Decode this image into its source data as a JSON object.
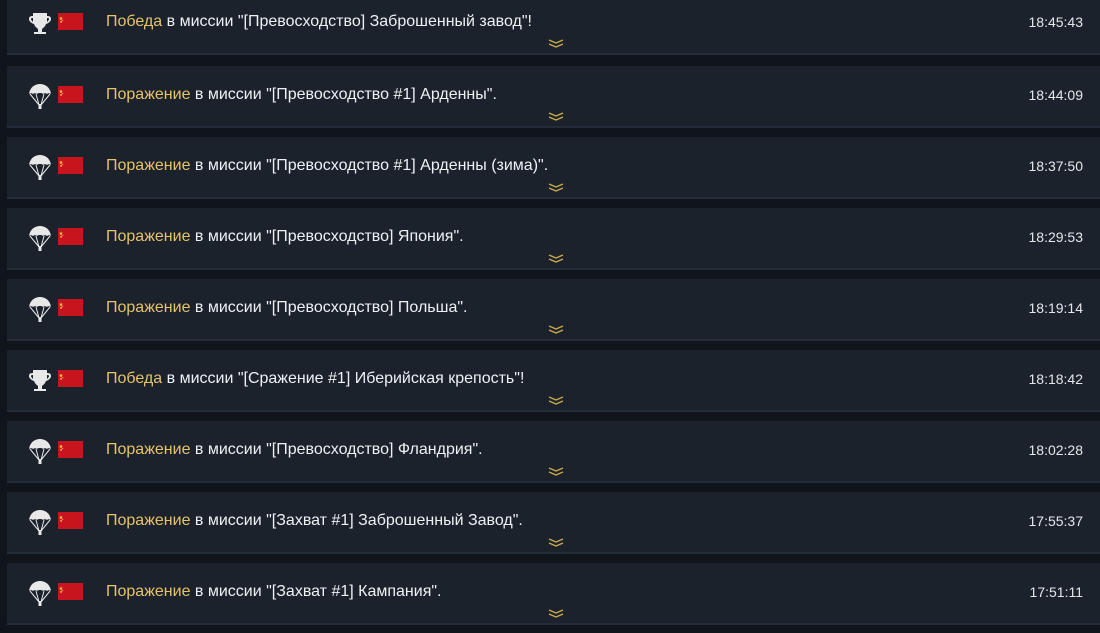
{
  "entries": [
    {
      "icon": "trophy-icon",
      "result": "Победа",
      "mid": " в миссии ",
      "mission": "\"[Превосходство] Заброшенный завод\"",
      "end": "!",
      "time": "18:45:43"
    },
    {
      "icon": "parachute-icon",
      "result": "Поражение",
      "mid": " в миссии ",
      "mission": "\"[Превосходство #1] Арденны\"",
      "end": ".",
      "time": "18:44:09"
    },
    {
      "icon": "parachute-icon",
      "result": "Поражение",
      "mid": " в миссии ",
      "mission": "\"[Превосходство #1] Арденны (зима)\"",
      "end": ".",
      "time": "18:37:50"
    },
    {
      "icon": "parachute-icon",
      "result": "Поражение",
      "mid": " в миссии ",
      "mission": "\"[Превосходство] Япония\"",
      "end": ".",
      "time": "18:29:53"
    },
    {
      "icon": "parachute-icon",
      "result": "Поражение",
      "mid": " в миссии ",
      "mission": "\"[Превосходство] Польша\"",
      "end": ".",
      "time": "18:19:14"
    },
    {
      "icon": "trophy-icon",
      "result": "Победа",
      "mid": " в миссии ",
      "mission": "\"[Сражение #1] Иберийская крепость\"",
      "end": "!",
      "time": "18:18:42"
    },
    {
      "icon": "parachute-icon",
      "result": "Поражение",
      "mid": " в миссии ",
      "mission": "\"[Превосходство] Фландрия\"",
      "end": ".",
      "time": "18:02:28"
    },
    {
      "icon": "parachute-icon",
      "result": "Поражение",
      "mid": " в миссии ",
      "mission": "\"[Захват #1] Заброшенный Завод\"",
      "end": ".",
      "time": "17:55:37"
    },
    {
      "icon": "parachute-icon",
      "result": "Поражение",
      "mid": " в миссии ",
      "mission": "\"[Захват #1] Кампания\"",
      "end": ".",
      "time": "17:51:11"
    }
  ],
  "colors": {
    "result": "#e6c36a",
    "text": "#eef1f4",
    "row_bg": "#1b222c",
    "flag": "#c8141c",
    "emblem": "#f3c23a"
  }
}
